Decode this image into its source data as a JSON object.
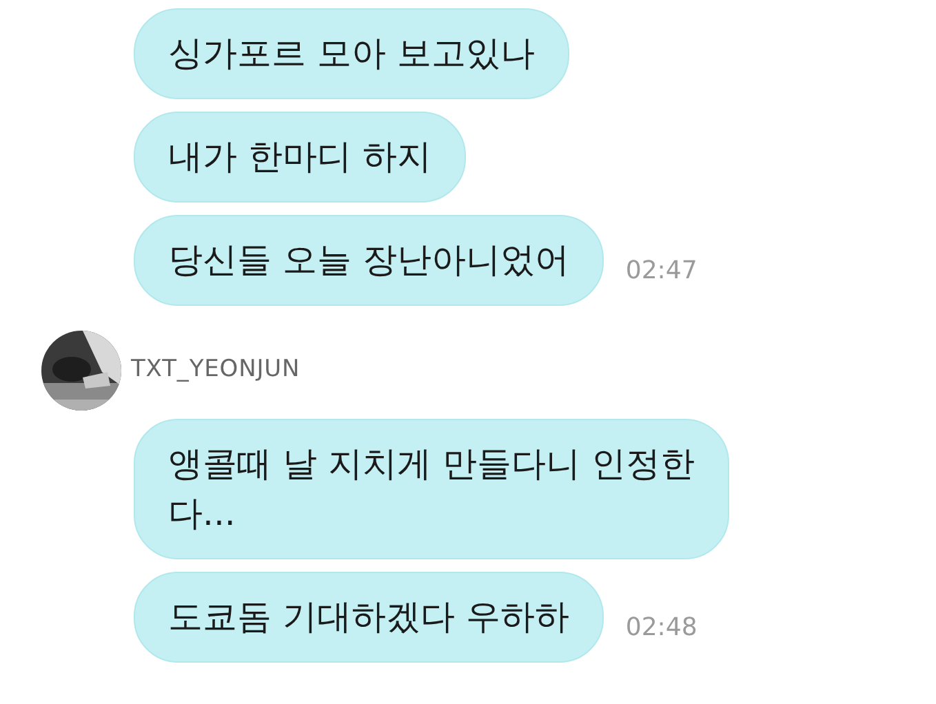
{
  "groups": [
    {
      "messages": [
        {
          "text": "싱가포르 모아 보고있나"
        },
        {
          "text": "내가 한마디 하지"
        },
        {
          "text": "당신들 오늘 장난아니었어",
          "time": "02:47"
        }
      ]
    },
    {
      "sender": "TXT_YEONJUN",
      "avatar": {
        "kind": "picture"
      },
      "messages": [
        {
          "text": "앵콜때 날 지치게 만들다니 인정한다..."
        },
        {
          "text": "도쿄돔 기대하겠다 우하하",
          "time": "02:48"
        }
      ]
    }
  ]
}
